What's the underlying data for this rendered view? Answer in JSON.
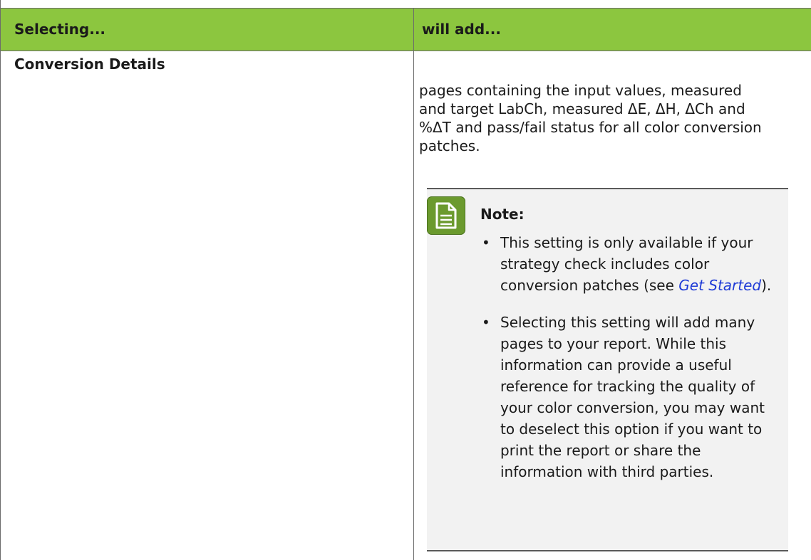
{
  "table": {
    "header": {
      "col1": "Selecting...",
      "col2": "will add..."
    },
    "row": {
      "setting": "Conversion Details",
      "description": "pages containing the input values, measured\nand target LabCh, measured ΔE, ΔH, ΔCh and\n%ΔT and pass/fail status for all color conversion\npatches."
    }
  },
  "note": {
    "icon": "note-document-icon",
    "title": "Note:",
    "items": [
      {
        "bullet": "•",
        "text_before_link": "This setting is only available if your strategy check includes color conversion patches (see ",
        "link_text": "Get Started",
        "text_after_link": ")."
      },
      {
        "bullet": "•",
        "text": "Selecting this setting will add many pages to your report. While this information can provide a useful reference for tracking the quality of your color conversion, you may want to deselect this option if you want to print the report or share the information with third parties."
      }
    ]
  },
  "colors": {
    "header_background": "#8cc63f",
    "note_icon": "#6b9a2e",
    "link": "#1f3bd6",
    "note_background": "#f2f2f2"
  }
}
